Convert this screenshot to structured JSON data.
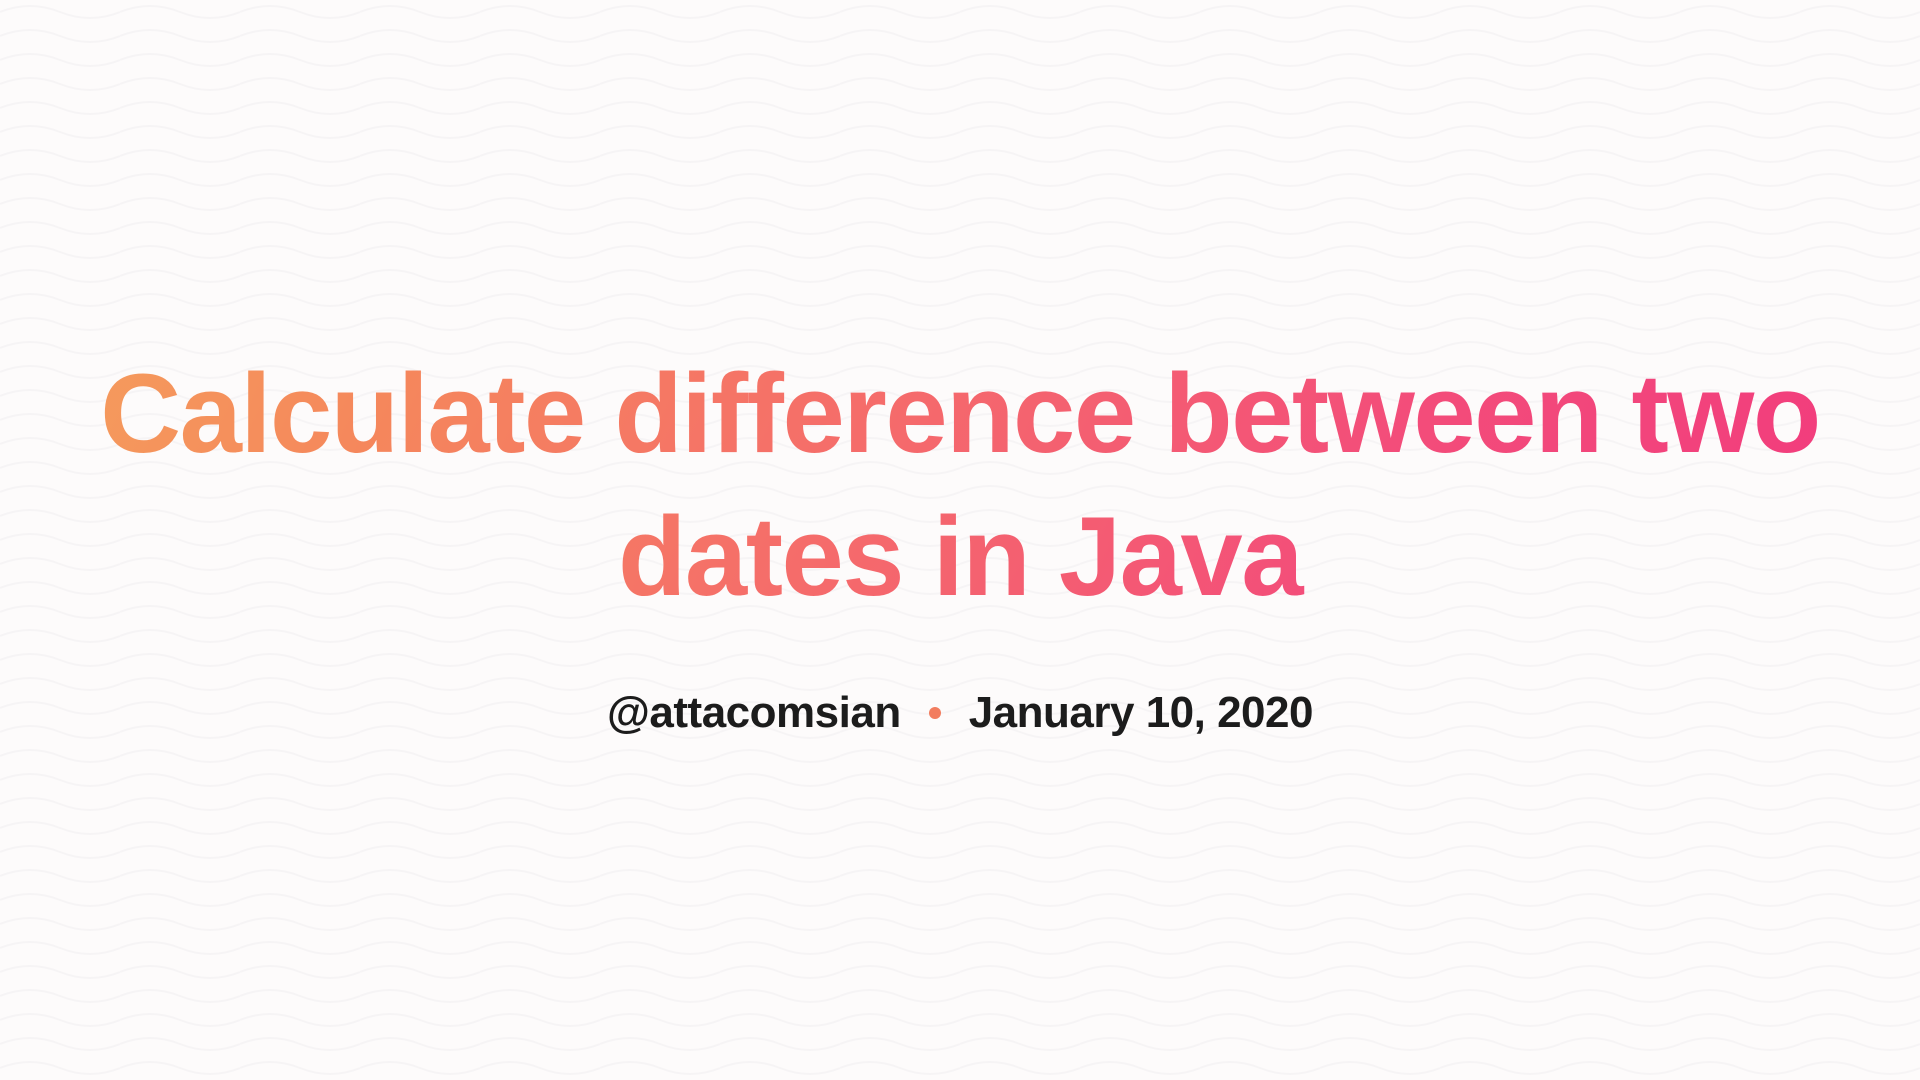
{
  "title": "Calculate difference between two dates in Java",
  "author_handle": "@attacomsian",
  "date": "January 10, 2020"
}
